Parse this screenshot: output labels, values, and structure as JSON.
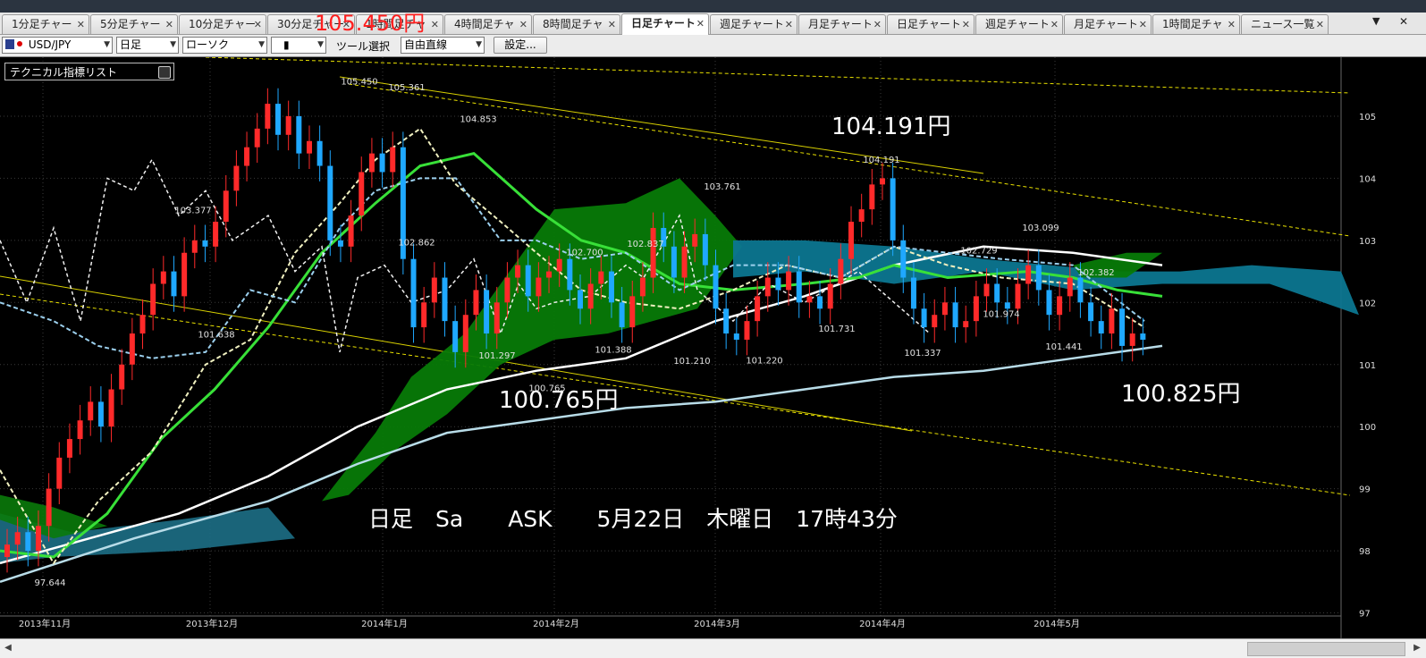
{
  "tabs": [
    {
      "label": "1分足チャー"
    },
    {
      "label": "5分足チャー"
    },
    {
      "label": "10分足チャー"
    },
    {
      "label": "30分足チャー"
    },
    {
      "label": "1時間足チャ"
    },
    {
      "label": "4時間足チャ"
    },
    {
      "label": "8時間足チャ"
    },
    {
      "label": "日足チャート",
      "active": true
    },
    {
      "label": "週足チャート"
    },
    {
      "label": "月足チャート"
    },
    {
      "label": "日足チャート"
    },
    {
      "label": "週足チャート"
    },
    {
      "label": "月足チャート"
    },
    {
      "label": "1時間足チャ"
    },
    {
      "label": "ニュース一覧"
    }
  ],
  "toolbar": {
    "symbol": "USD/JPY",
    "period": "日足",
    "chart_style": "ローソク",
    "candle_type": "▮",
    "tool_label": "ツール選択",
    "tool_value": "自由直線",
    "settings_label": "設定..."
  },
  "indicator_panel": {
    "title": "テクニカル指標リスト"
  },
  "annotations": {
    "top_price": "105.450円",
    "mid_price": "104.191円",
    "low_price": "100.765円",
    "last_price": "100.825円",
    "info_line": "日足　Sa　　ASK　　5月22日　木曜日　17時43分"
  },
  "chart_data": {
    "type": "candlestick",
    "symbol": "USD/JPY",
    "y_axis_ticks": [
      97,
      98,
      99,
      100,
      101,
      102,
      103,
      104,
      105
    ],
    "ylim": [
      96.95,
      105.95
    ],
    "x_labels": [
      "2013年11月",
      "2013年12月",
      "2014年1月",
      "2014年2月",
      "2014年3月",
      "2014年4月",
      "2014年5月"
    ],
    "price_labels": [
      {
        "text": "105.450",
        "value": 105.45
      },
      {
        "text": "105.361",
        "value": 105.36
      },
      {
        "text": "104.853",
        "value": 104.85
      },
      {
        "text": "103.377",
        "value": 103.38
      },
      {
        "text": "102.862",
        "value": 102.86
      },
      {
        "text": "101.638",
        "value": 101.64
      },
      {
        "text": "101.297",
        "value": 101.3
      },
      {
        "text": "102.700",
        "value": 102.7
      },
      {
        "text": "102.837",
        "value": 102.84
      },
      {
        "text": "101.388",
        "value": 101.39
      },
      {
        "text": "100.765",
        "value": 100.77
      },
      {
        "text": "103.761",
        "value": 103.76
      },
      {
        "text": "101.210",
        "value": 101.21
      },
      {
        "text": "101.220",
        "value": 101.22
      },
      {
        "text": "104.191",
        "value": 104.19
      },
      {
        "text": "101.731",
        "value": 101.73
      },
      {
        "text": "101.337",
        "value": 101.34
      },
      {
        "text": "102.729",
        "value": 102.73
      },
      {
        "text": "101.974",
        "value": 101.97
      },
      {
        "text": "103.099",
        "value": 103.1
      },
      {
        "text": "102.382",
        "value": 102.38
      },
      {
        "text": "101.441",
        "value": 101.44
      },
      {
        "text": "97.644",
        "value": 97.64
      }
    ],
    "series": [
      {
        "values": [
          98.1,
          98.3,
          98.0,
          98.4,
          99.0,
          99.5,
          99.8,
          100.1,
          100.4,
          100.0,
          100.6,
          101.0,
          101.5,
          101.8,
          102.3,
          102.5,
          102.1,
          102.8,
          103.0,
          102.9,
          103.3,
          103.8,
          104.2,
          104.5,
          104.8,
          105.2,
          104.7,
          105.0,
          104.4,
          104.6,
          104.2,
          103.0,
          102.9,
          103.4,
          104.1,
          104.4,
          104.1,
          104.5,
          102.7,
          101.6,
          102.0,
          102.4,
          101.7,
          101.2,
          101.8,
          102.2,
          101.5,
          102.0,
          102.4,
          102.6,
          102.1,
          102.4,
          102.5,
          102.7,
          102.2,
          101.9,
          102.3,
          102.5,
          102.0,
          101.6,
          102.1,
          102.4,
          103.2,
          102.9,
          102.4,
          102.9,
          103.1,
          102.6,
          101.9,
          101.5,
          101.4,
          101.7,
          102.1,
          102.4,
          102.2,
          102.5,
          102.0,
          102.1,
          101.9,
          102.3,
          102.7,
          103.3,
          103.5,
          103.9,
          104.0,
          103.0,
          102.4,
          101.9,
          101.6,
          101.8,
          102.0,
          101.6,
          101.7,
          102.1,
          102.3,
          102.0,
          101.9,
          102.3,
          102.6,
          102.2,
          101.8,
          102.1,
          102.4,
          102.0,
          101.7,
          101.5,
          101.9,
          101.3,
          101.5,
          101.4
        ]
      }
    ]
  }
}
